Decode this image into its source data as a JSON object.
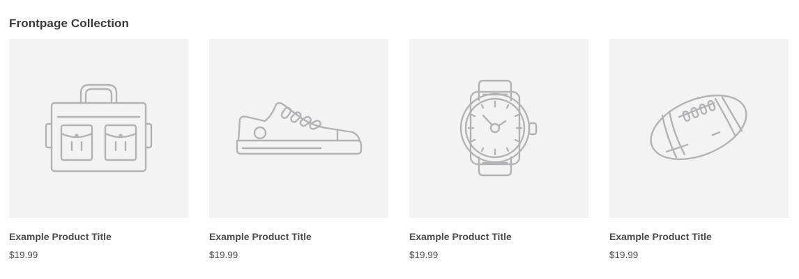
{
  "section": {
    "title": "Frontpage Collection"
  },
  "products": [
    {
      "icon": "bag-icon",
      "title": "Example Product Title",
      "price": "$19.99"
    },
    {
      "icon": "sneaker-icon",
      "title": "Example Product Title",
      "price": "$19.99"
    },
    {
      "icon": "watch-icon",
      "title": "Example Product Title",
      "price": "$19.99"
    },
    {
      "icon": "football-icon",
      "title": "Example Product Title",
      "price": "$19.99"
    }
  ],
  "colors": {
    "placeholder_bg": "#f3f3f3",
    "icon_stroke": "#b3b3b5",
    "text": "#4a4a4a"
  }
}
